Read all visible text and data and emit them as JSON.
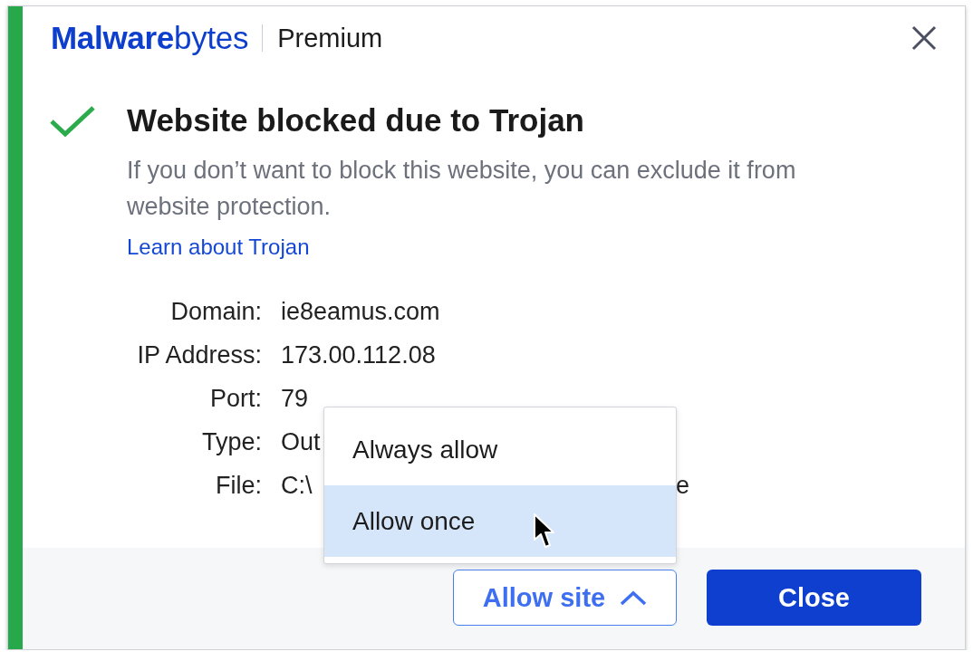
{
  "header": {
    "brand": "**Malware**bytes",
    "edition": "Premium"
  },
  "title": "Website blocked due to Trojan",
  "description": "If you don’t want to block this website, you can exclude it from website protection.",
  "link": "Learn about Trojan",
  "details": [
    {
      "label": "Domain:",
      "value": "ie8eamus.com"
    },
    {
      "label": "IP Address:",
      "value": "173.00.112.08"
    },
    {
      "label": "Port:",
      "value": "79"
    },
    {
      "label": "Type:",
      "value": "Out"
    },
    {
      "label": "File:",
      "value": "C:\\",
      "value_tail": "e"
    }
  ],
  "buttons": [
    {
      "label": "Allow site",
      "kind": "dropdown",
      "expanded": true,
      "menu": [
        {
          "label": "Always allow",
          "selected": false
        },
        {
          "label": "Allow once",
          "selected": true
        }
      ]
    },
    {
      "label": "Close",
      "kind": "primary"
    }
  ]
}
